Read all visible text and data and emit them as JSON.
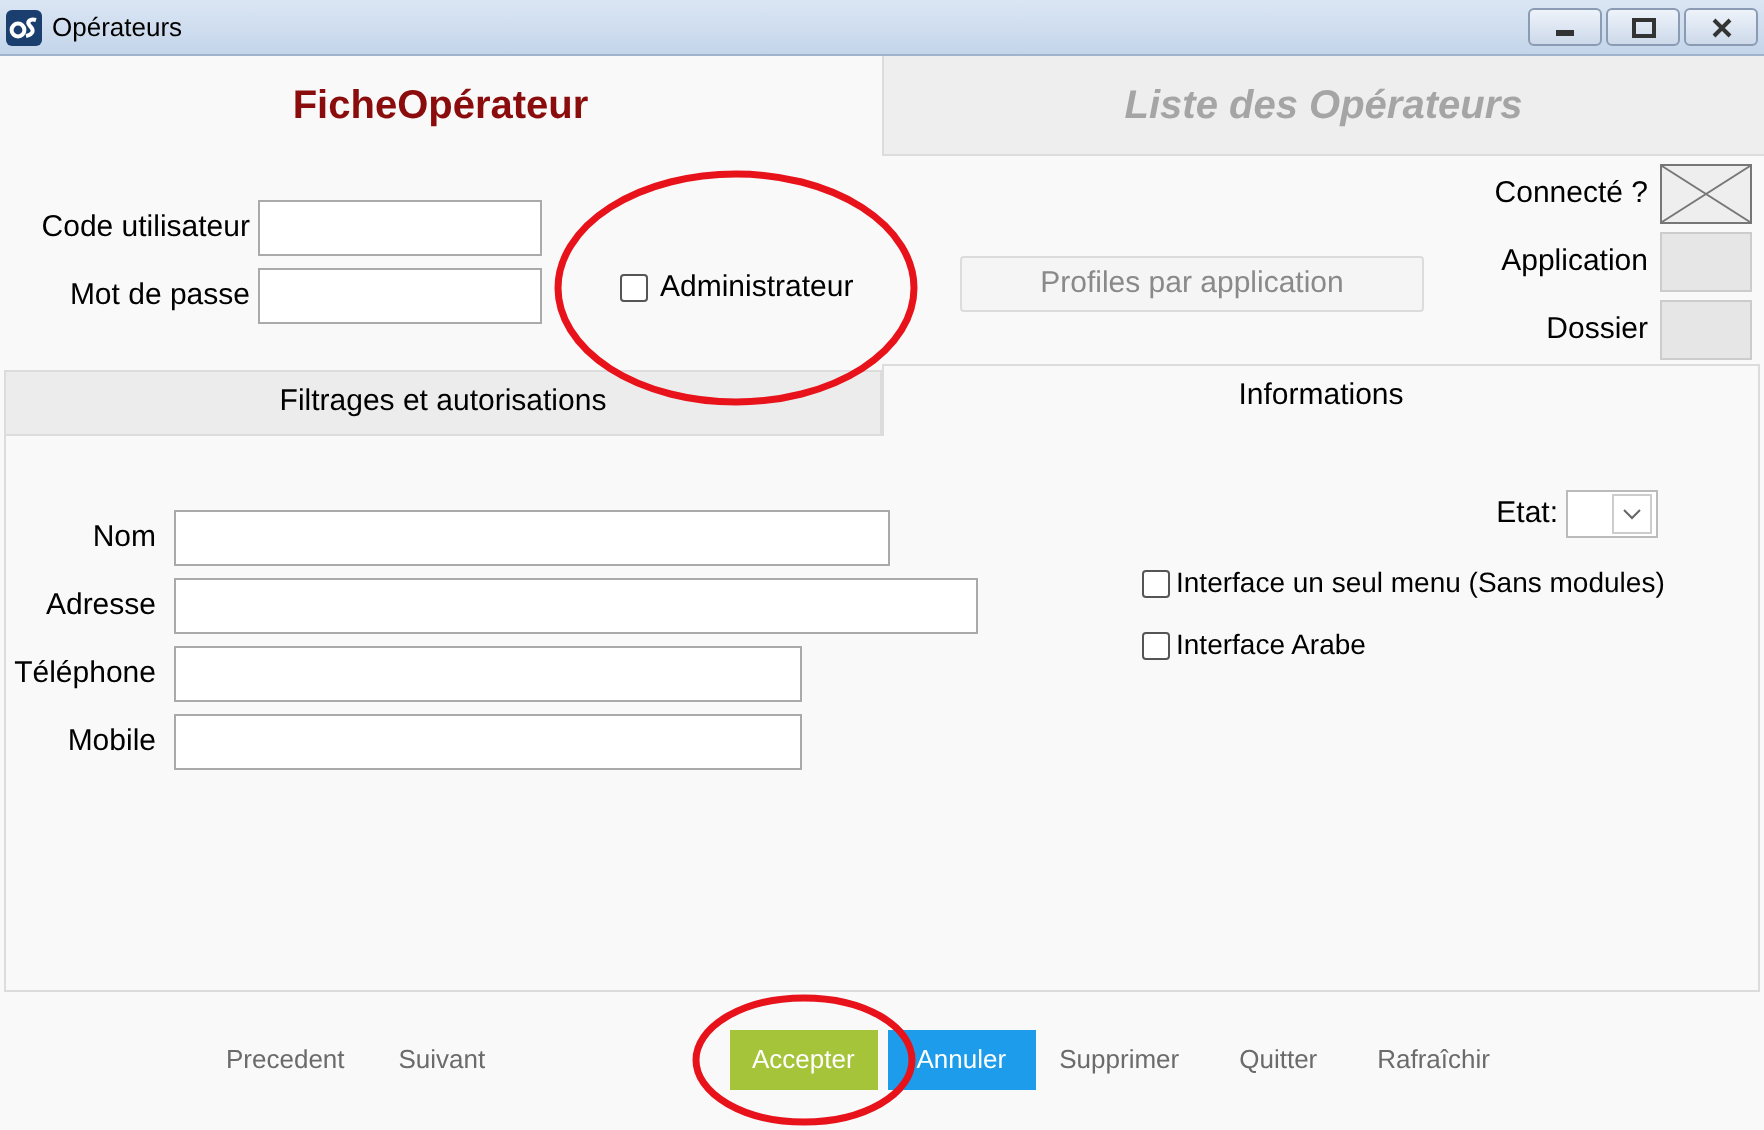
{
  "window": {
    "title": "Opérateurs"
  },
  "tabs": [
    {
      "label": "FicheOpérateur",
      "selected": true
    },
    {
      "label": "Liste des Opérateurs",
      "selected": false
    }
  ],
  "login": {
    "fields": [
      {
        "label": "Code utilisateur"
      },
      {
        "label": "Mot de passe"
      }
    ],
    "admin": {
      "label": "Administrateur",
      "checked": false,
      "highlighted": true
    },
    "profiles_button": {
      "label": "Profiles par application",
      "disabled": true
    }
  },
  "status": [
    {
      "label": "Connecté ?",
      "kind": "crossed"
    },
    {
      "label": "Application",
      "kind": "blank"
    },
    {
      "label": "Dossier",
      "kind": "blank"
    }
  ],
  "subtabs": [
    {
      "label": "Filtrages et autorisations",
      "selected": false
    },
    {
      "label": "Informations",
      "selected": true
    }
  ],
  "info": {
    "fields": [
      {
        "label": "Nom",
        "kind": "medium"
      },
      {
        "label": "Adresse",
        "kind": "long"
      },
      {
        "label": "Téléphone",
        "kind": "short"
      },
      {
        "label": "Mobile",
        "kind": "short"
      }
    ],
    "state_label": "Etat:",
    "options": [
      {
        "label": "Interface un seul menu (Sans modules)",
        "checked": false
      },
      {
        "label": "Interface Arabe",
        "checked": false
      }
    ]
  },
  "actions": [
    {
      "label": "Precedent",
      "kind": "link"
    },
    {
      "label": "Suivant",
      "kind": "link"
    },
    {
      "label": "Accepter",
      "kind": "accept",
      "highlighted": true
    },
    {
      "label": "Annuler",
      "kind": "cancel"
    },
    {
      "label": "Supprimer",
      "kind": "link"
    },
    {
      "label": "Quitter",
      "kind": "link"
    },
    {
      "label": "Rafraîchir",
      "kind": "link"
    }
  ]
}
